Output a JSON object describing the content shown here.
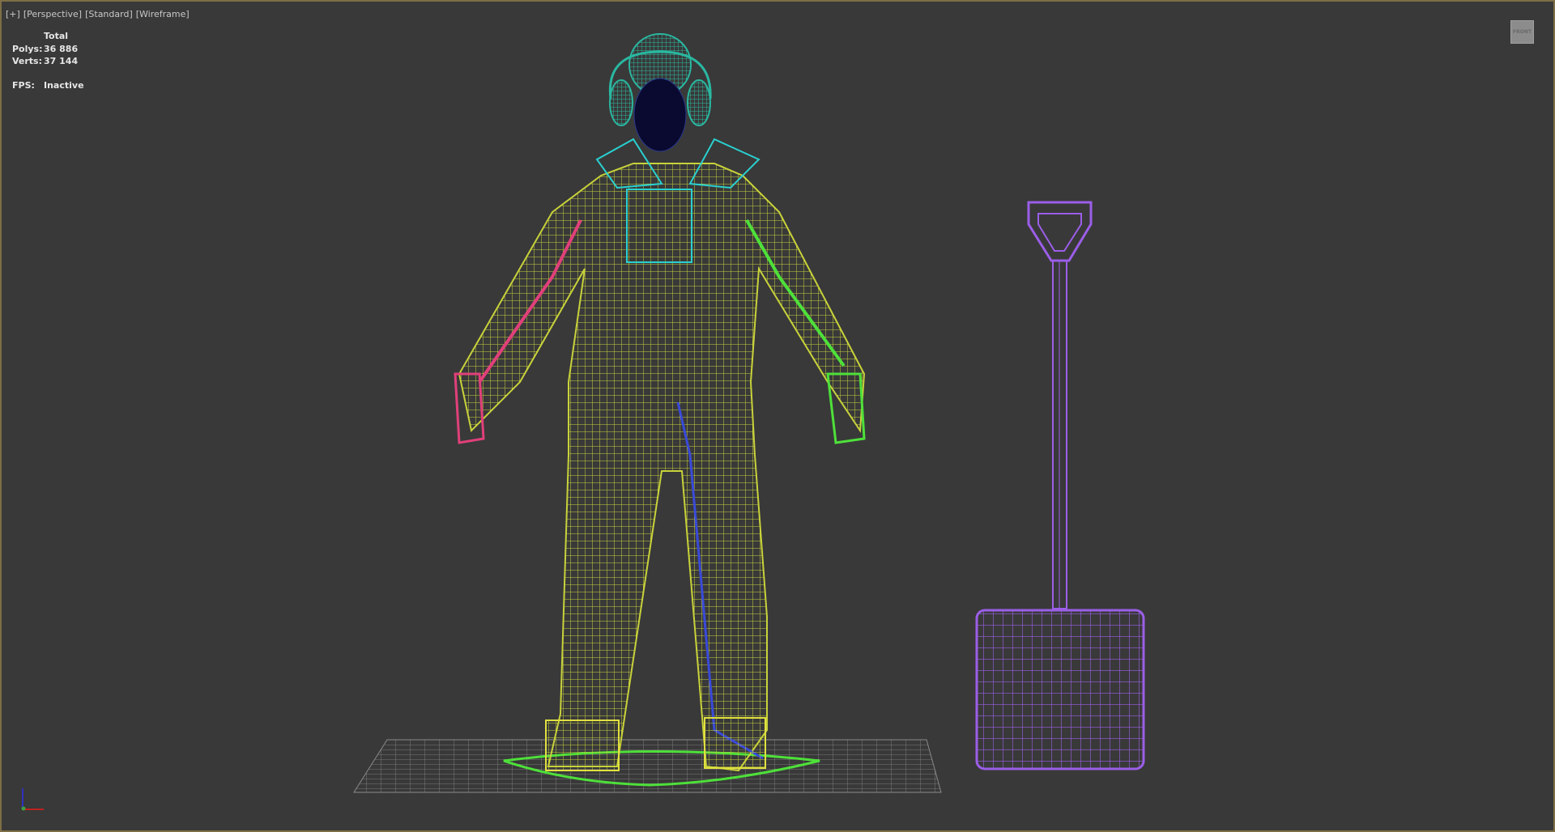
{
  "viewport": {
    "menu": [
      "[+]",
      "[Perspective]",
      "[Standard]",
      "[Wireframe]"
    ],
    "stats": {
      "header": "Total",
      "polys_label": "Polys:",
      "polys_value": "36 886",
      "verts_label": "Verts:",
      "verts_value": "37 144",
      "fps_label": "FPS:",
      "fps_value": "Inactive"
    },
    "viewcube_label": "FRONT",
    "colors": {
      "background": "#393939",
      "border": "#7d6f45",
      "body": "#c8d23a",
      "helmet": "#2ab7a0",
      "collar": "#2ad0d0",
      "left_arm": "#e0407a",
      "right_arm": "#4ee03a",
      "shovel": "#9b5ee8",
      "legs_inner": "#3a4ad8"
    }
  }
}
